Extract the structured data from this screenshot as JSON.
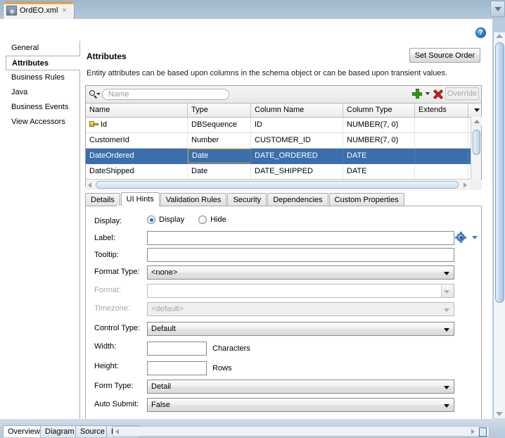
{
  "window": {
    "document_tab": {
      "label": "OrdEO.xml",
      "icon": "entity-object-icon",
      "close": "×"
    },
    "topright_button_icon": "chevron-down-icon",
    "help_icon_label": "?"
  },
  "sidebar": {
    "items": [
      {
        "label": "General",
        "selected": false
      },
      {
        "label": "Attributes",
        "selected": true
      },
      {
        "label": "Business Rules",
        "selected": false
      },
      {
        "label": "Java",
        "selected": false
      },
      {
        "label": "Business Events",
        "selected": false
      },
      {
        "label": "View Accessors",
        "selected": false
      }
    ]
  },
  "panel": {
    "title": "Attributes",
    "set_source_order_label": "Set Source Order",
    "description": "Entity attributes can be based upon columns in the schema object or can be based upon transient values."
  },
  "toolbar": {
    "search_placeholder": "Name",
    "search_value": "",
    "add_icon": "plus-icon",
    "add_dropdown_icon": "chevron-down-icon",
    "delete_icon": "delete-x-icon",
    "override_label": "Override"
  },
  "grid": {
    "columns": [
      "Name",
      "Type",
      "Column Name",
      "Column Type",
      "Extends"
    ],
    "rows": [
      {
        "name": "Id",
        "type": "DBSequence",
        "column_name": "ID",
        "column_type": "NUMBER(7, 0)",
        "extends": "",
        "key": true,
        "selected": false
      },
      {
        "name": "CustomerId",
        "type": "Number",
        "column_name": "CUSTOMER_ID",
        "column_type": "NUMBER(7, 0)",
        "extends": "",
        "key": false,
        "selected": false
      },
      {
        "name": "DateOrdered",
        "type": "Date",
        "column_name": "DATE_ORDERED",
        "column_type": "DATE",
        "extends": "",
        "key": false,
        "selected": true
      },
      {
        "name": "DateShipped",
        "type": "Date",
        "column_name": "DATE_SHIPPED",
        "column_type": "DATE",
        "extends": "",
        "key": false,
        "selected": false
      }
    ]
  },
  "subtabs": [
    {
      "label": "Details",
      "active": false
    },
    {
      "label": "UI Hints",
      "active": true
    },
    {
      "label": "Validation Rules",
      "active": false
    },
    {
      "label": "Security",
      "active": false
    },
    {
      "label": "Dependencies",
      "active": false
    },
    {
      "label": "Custom Properties",
      "active": false
    }
  ],
  "ui_hints": {
    "display_label": "Display:",
    "display_option": "Display",
    "hide_option": "Hide",
    "label_label": "Label:",
    "label_value": "",
    "tooltip_label": "Tooltip:",
    "tooltip_value": "",
    "format_type_label": "Format Type:",
    "format_type_value": "<none>",
    "format_label": "Format:",
    "format_value": "",
    "timezone_label": "Timezone:",
    "timezone_value": "<default>",
    "control_type_label": "Control Type:",
    "control_type_value": "Default",
    "width_label": "Width:",
    "width_value": "",
    "width_unit": "Characters",
    "height_label": "Height:",
    "height_value": "",
    "height_unit": "Rows",
    "form_type_label": "Form Type:",
    "form_type_value": "Detail",
    "auto_submit_label": "Auto Submit:",
    "auto_submit_value": "False",
    "gear_icon": "gear-icon",
    "gear_dropdown_icon": "chevron-down-icon"
  },
  "bottom_tabs": [
    {
      "label": "Overview",
      "active": true
    },
    {
      "label": "Diagram",
      "active": false
    },
    {
      "label": "Source",
      "active": false
    },
    {
      "label": "History",
      "active": false
    }
  ],
  "colors": {
    "selection_blue": "#3a6fab",
    "focus_cell_border": "#d9a441",
    "accent_orange": "#e8a33d",
    "window_chrome": "#b9cbdd"
  }
}
